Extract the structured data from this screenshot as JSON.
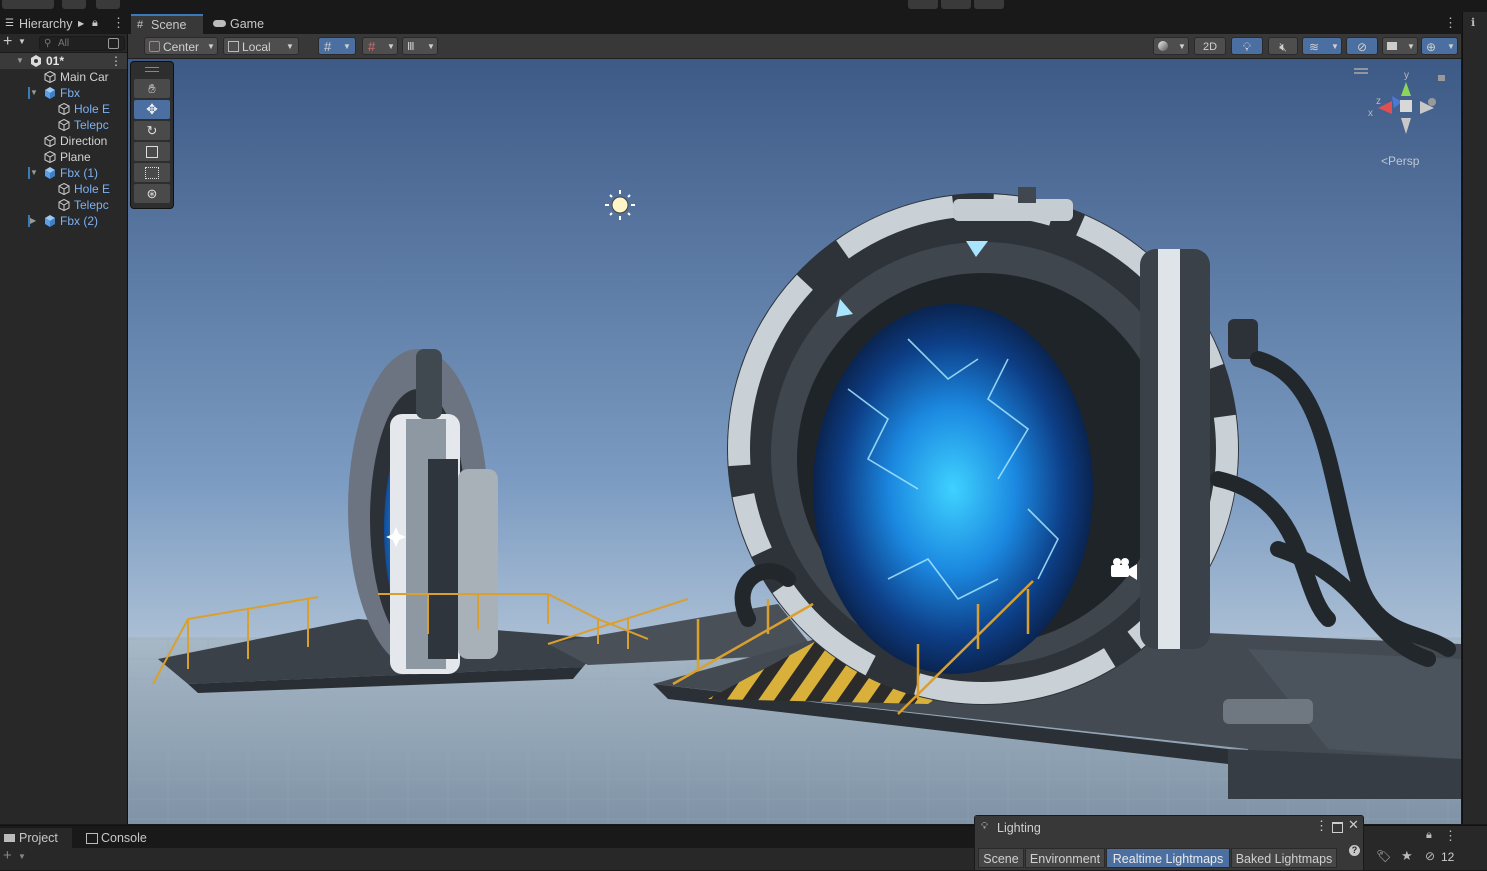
{
  "top_tabs": {
    "hierarchy": "Hierarchy",
    "scene": "Scene",
    "game": "Game"
  },
  "hierarchy": {
    "search_placeholder": "All",
    "items": [
      {
        "label": "01*",
        "depth": 0,
        "kind": "scene",
        "arrow": "open"
      },
      {
        "label": "Main Car",
        "depth": 1,
        "kind": "object",
        "arrow": "none"
      },
      {
        "label": "Fbx",
        "depth": 1,
        "kind": "prefab",
        "arrow": "open"
      },
      {
        "label": "Hole E",
        "depth": 2,
        "kind": "object",
        "arrow": "none"
      },
      {
        "label": "Telepc",
        "depth": 2,
        "kind": "object",
        "arrow": "none"
      },
      {
        "label": "Direction",
        "depth": 1,
        "kind": "object",
        "arrow": "none"
      },
      {
        "label": "Plane",
        "depth": 1,
        "kind": "object",
        "arrow": "none"
      },
      {
        "label": "Fbx (1)",
        "depth": 1,
        "kind": "prefab",
        "arrow": "open"
      },
      {
        "label": "Hole E",
        "depth": 2,
        "kind": "object",
        "arrow": "none"
      },
      {
        "label": "Telepc",
        "depth": 2,
        "kind": "object",
        "arrow": "none"
      },
      {
        "label": "Fbx (2)",
        "depth": 1,
        "kind": "prefab",
        "arrow": "closed"
      }
    ]
  },
  "scene_toolbar": {
    "pivot": "Center",
    "space": "Local",
    "mode_2d": "2D"
  },
  "gizmo": {
    "projection": "Persp",
    "axis_y": "y",
    "axis_x": "x",
    "axis_z": "z"
  },
  "bottom_tabs": {
    "project": "Project",
    "console": "Console"
  },
  "lighting": {
    "title": "Lighting",
    "tabs": [
      "Scene",
      "Environment",
      "Realtime Lightmaps",
      "Baked Lightmaps"
    ],
    "active_tab": "Realtime Lightmaps",
    "hidden_count": "12"
  },
  "colors": {
    "accent": "#3a79bb",
    "prefab_text": "#7cb1f0",
    "portal_glow": "#2aa8ff",
    "railing": "#d9a030"
  }
}
